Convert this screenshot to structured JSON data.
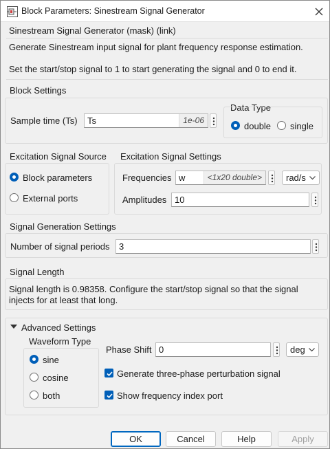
{
  "window": {
    "title": "Block Parameters: Sinestream Signal Generator",
    "icon": "simulink-block-icon",
    "close_icon": "close-icon"
  },
  "mask": {
    "heading": "Sinestream Signal Generator (mask) (link)",
    "desc1": "Generate Sinestream input signal for plant frequency response estimation.",
    "desc2": "Set the start/stop signal to 1 to start generating the signal and 0 to end it."
  },
  "block_settings": {
    "title": "Block Settings",
    "sample_time_label": "Sample time (Ts)",
    "sample_time_value": "Ts",
    "sample_time_hint": "1e-06",
    "data_type": {
      "title": "Data Type",
      "options": [
        "double",
        "single"
      ],
      "selected": "double"
    }
  },
  "excitation_source": {
    "title": "Excitation Signal Source",
    "options": [
      "Block parameters",
      "External ports"
    ],
    "selected": "Block parameters"
  },
  "excitation_settings": {
    "title": "Excitation Signal Settings",
    "frequencies_label": "Frequencies",
    "frequencies_value": "w",
    "frequencies_hint": "<1x20 double>",
    "freq_unit": "rad/s",
    "amplitudes_label": "Amplitudes",
    "amplitudes_value": "10"
  },
  "signal_generation": {
    "title": "Signal Generation Settings",
    "periods_label": "Number of signal periods",
    "periods_value": "3"
  },
  "signal_length": {
    "title": "Signal Length",
    "line1": "Signal length is 0.98358. Configure the start/stop signal so that the signal",
    "line2": "injects for at least that long."
  },
  "advanced": {
    "title": "Advanced Settings",
    "expanded": true,
    "waveform": {
      "title": "Waveform Type",
      "options": [
        "sine",
        "cosine",
        "both"
      ],
      "selected": "sine"
    },
    "phase_shift_label": "Phase Shift",
    "phase_shift_value": "0",
    "phase_unit": "deg",
    "three_phase_label": "Generate three-phase perturbation signal",
    "three_phase_checked": true,
    "freq_index_label": "Show frequency index port",
    "freq_index_checked": true
  },
  "buttons": {
    "ok": "OK",
    "cancel": "Cancel",
    "help": "Help",
    "apply": "Apply"
  },
  "colors": {
    "accent": "#005fb8",
    "background": "#f0f0f0"
  }
}
